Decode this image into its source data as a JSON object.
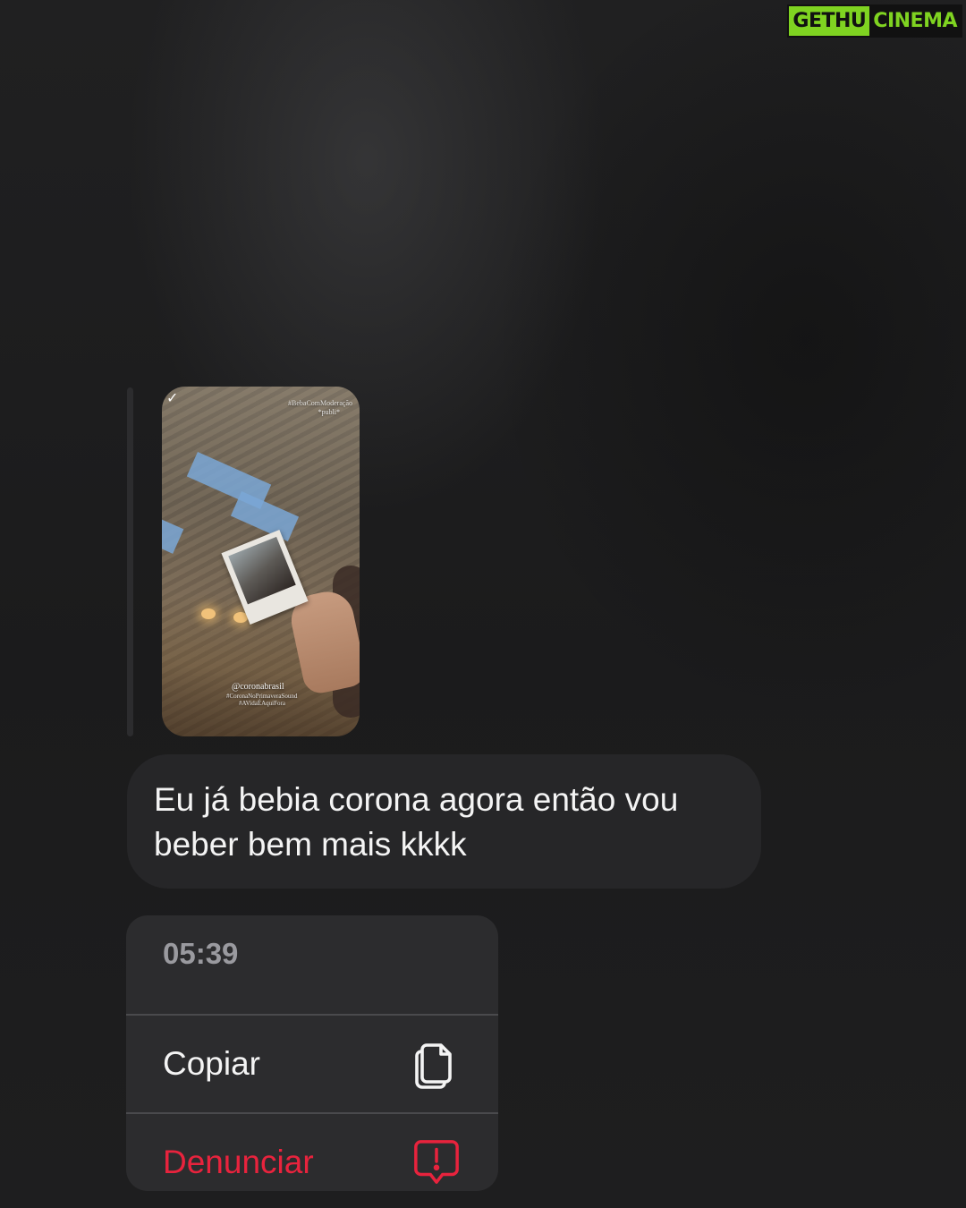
{
  "watermark": {
    "left": "GETHU",
    "right": "CINEMA"
  },
  "story": {
    "hashtag_top": "#BebaComModeração",
    "publi": "*publi*",
    "mention": "@coronabrasil",
    "tag1": "#CoronaNoPrimaveraSound",
    "tag2": "#AVidaÉAquiFora",
    "icon": "story-ring-icon"
  },
  "message": {
    "text": "Eu já bebia corona agora então vou beber bem mais  kkkk"
  },
  "menu": {
    "time": "05:39",
    "items": [
      {
        "label": "Copiar",
        "icon": "copy-icon",
        "color": "#f4f4f4"
      },
      {
        "label": "Denunciar",
        "icon": "report-icon",
        "color": "#e8233d"
      }
    ]
  },
  "colors": {
    "background": "#1d1d1e",
    "bubble": "#262628",
    "menu": "#2c2c2e",
    "danger": "#e8233d",
    "watermark_green": "#7fd321"
  }
}
